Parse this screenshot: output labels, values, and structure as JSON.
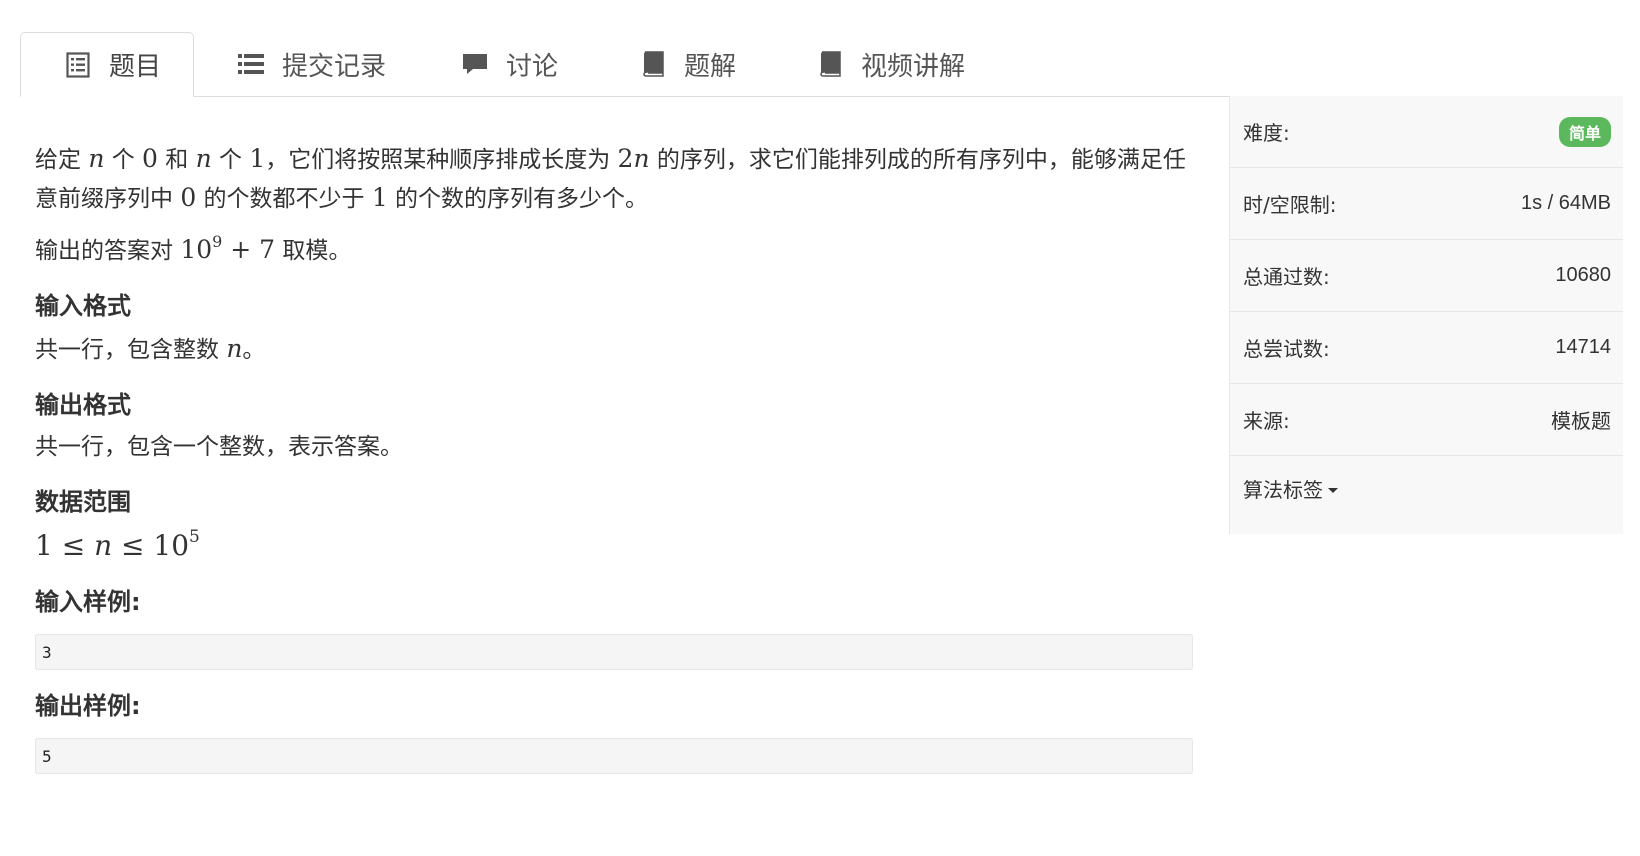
{
  "tabs": [
    {
      "label": "题目",
      "icon": "document-list-icon",
      "active": true
    },
    {
      "label": "提交记录",
      "icon": "list-icon",
      "active": false
    },
    {
      "label": "讨论",
      "icon": "comment-icon",
      "active": false
    },
    {
      "label": "题解",
      "icon": "book-icon",
      "active": false
    },
    {
      "label": "视频讲解",
      "icon": "book-icon",
      "active": false
    }
  ],
  "problem": {
    "desc1": {
      "t1": "给定 ",
      "m1": "n",
      "t2": " 个 ",
      "m2": "0",
      "t3": " 和 ",
      "m3": "n",
      "t4": " 个 ",
      "m4": "1",
      "t5": "，它们将按照某种顺序排成长度为 ",
      "m5a": "2",
      "m5b": "n",
      "t6": " 的序列，求它们能排列成的所有序列中，能够满足任意前缀序列中 ",
      "m6": "0",
      "t7": " 的个数都不少于 ",
      "m7": "1",
      "t8": " 的个数的序列有多少个。"
    },
    "desc2": {
      "t1": "输出的答案对 ",
      "base": "10",
      "exp": "9",
      "rest": " + 7",
      "t2": " 取模。"
    },
    "input_heading": "输入格式",
    "input_text": {
      "t1": "共一行，包含整数 ",
      "m1": "n",
      "t2": "。"
    },
    "output_heading": "输出格式",
    "output_text": "共一行，包含一个整数，表示答案。",
    "range_heading": "数据范围",
    "range": {
      "a": "1 ≤ ",
      "n": "n",
      "b": " ≤ 10",
      "exp": "5"
    },
    "sample_input_heading": "输入样例:",
    "sample_input": "3",
    "sample_output_heading": "输出样例:",
    "sample_output": "5"
  },
  "sidebar": {
    "difficulty_label": "难度:",
    "difficulty_value": "简单",
    "limit_label": "时/空限制:",
    "limit_value": "1s / 64MB",
    "passed_label": "总通过数:",
    "passed_value": "10680",
    "tried_label": "总尝试数:",
    "tried_value": "14714",
    "source_label": "来源:",
    "source_value": "模板题",
    "tags_label": "算法标签"
  },
  "colors": {
    "difficulty_badge": "#5cb85c",
    "tab_text": "#555555",
    "icon": "#555555"
  }
}
